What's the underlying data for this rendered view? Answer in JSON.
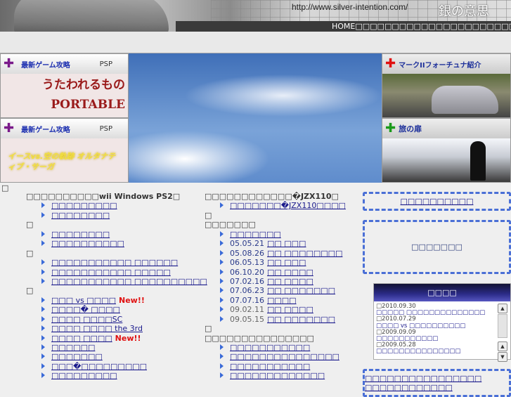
{
  "header": {
    "url": "http://www.silver-intention.com/",
    "site_title": "銀の意思",
    "home_nav": "HOME□□□□□□□□□□□□□□□□□□□□□□□□□□□□□□□□□□□□□"
  },
  "top_links": [
    "□□□□□□□□□□□□",
    "□□□□□□□□□□",
    "□□□□□□□□□□□□□□□□□□□□□□□"
  ],
  "banners": {
    "left": [
      {
        "label": "最新ゲーム攻略",
        "platform": "PSP",
        "title": "うたわれるもの PORTABLE"
      },
      {
        "label": "最新ゲーム攻略",
        "platform": "PSP",
        "title": "イースvs.空の軌跡 オルタナティブ・サーガ"
      }
    ],
    "right": [
      {
        "label": "マークIIフォーチュナ紹介"
      },
      {
        "label": "旅の扉"
      }
    ]
  },
  "misc": {
    "box": "□"
  },
  "left_col": [
    {
      "type": "head",
      "text": "□□□□□□□□□□wii Windows PS2□"
    },
    {
      "type": "link",
      "text": "□□□□□□□□□"
    },
    {
      "type": "link",
      "text": "□□□□□□□□"
    },
    {
      "type": "head",
      "text": "□"
    },
    {
      "type": "link",
      "text": "□□□□□□□□"
    },
    {
      "type": "link",
      "text": "□□□□□□□□□□"
    },
    {
      "type": "head",
      "text": "□"
    },
    {
      "type": "link",
      "text": "□□□□□□□□□□□ □□□□□□"
    },
    {
      "type": "link",
      "text": "□□□□□□□□□□□ □□□□□"
    },
    {
      "type": "link",
      "text": "□□□□□□□□□□□ □□□□□□□□□□"
    },
    {
      "type": "head",
      "text": "□"
    },
    {
      "type": "link",
      "text": "□□□ vs □□□□",
      "badge": "New!!"
    },
    {
      "type": "link",
      "text": "□□□□� □□□□"
    },
    {
      "type": "link",
      "text": "□□□□ □□□□SC"
    },
    {
      "type": "link",
      "text": "□□□□ □□□□ the 3rd"
    },
    {
      "type": "link",
      "text": "□□□□ □□□□",
      "badge": "New!!"
    },
    {
      "type": "link",
      "text": "□□□□□□"
    },
    {
      "type": "link",
      "text": "□□□□□□□"
    },
    {
      "type": "link",
      "text": "□□□�□□□□□□□□□"
    },
    {
      "type": "link",
      "text": "□□□□□□□□□"
    }
  ],
  "mid_col": [
    {
      "type": "head",
      "text": "□□□□□□□□□□□□�JZX110□"
    },
    {
      "type": "link",
      "text": "□□□□□□□�JZX110□□□□"
    },
    {
      "type": "head",
      "text": "□"
    },
    {
      "type": "head",
      "text": "□□□□□□□"
    },
    {
      "type": "link",
      "text": "□□□□□□□"
    },
    {
      "type": "link",
      "date": "05.05.21",
      "text": "□□ □□□"
    },
    {
      "type": "link",
      "date": "05.08.26",
      "text": "□□ □□□□□□□□"
    },
    {
      "type": "link",
      "date": "06.05.13",
      "text": "□□ □□□"
    },
    {
      "type": "link",
      "date": "06.10.20",
      "text": "□□ □□□□"
    },
    {
      "type": "link",
      "date": "07.02.16",
      "text": "□□ □□□□"
    },
    {
      "type": "link",
      "date": "07.06.23",
      "text": "□□ □□□□□□□"
    },
    {
      "type": "link",
      "date": "07.07.16",
      "text": "□□□□"
    },
    {
      "type": "link",
      "date": "09.02.11",
      "text": "□□ □□□□",
      "dim": true
    },
    {
      "type": "link",
      "date": "09.05.15",
      "text": "□□ □□□□□□□",
      "dim": true
    },
    {
      "type": "head",
      "text": "□"
    },
    {
      "type": "head",
      "text": "□□□□□□□□□□□□□□□"
    },
    {
      "type": "link",
      "text": "□□□□□□□□□□□"
    },
    {
      "type": "link",
      "text": "□□□□□□□□□□□□□□□"
    },
    {
      "type": "link",
      "text": "□□□□□□□□□□□"
    },
    {
      "type": "link",
      "text": "□□□□□□□□□□□□□"
    }
  ],
  "right_col": {
    "box1": "□□□□□□□□□□",
    "box2": "□□□□□□□",
    "box3": "□□□□□□□□□□□□□□□□ □□□□□□□□□□□□",
    "news_title": "□□□□",
    "news": [
      {
        "date": "□2010.09.30",
        "text": "□□□□□ □□□□□□□□□□□□□□"
      },
      {
        "date": "□2010.07.29",
        "text": "□□□□ vs □□□□□□□□□□"
      },
      {
        "date": "□2009.09.09",
        "text": "□□□□□□□□□□□"
      },
      {
        "date": "□2009.05.28",
        "text": "□□□□□□□□□□□□□□□"
      }
    ]
  }
}
